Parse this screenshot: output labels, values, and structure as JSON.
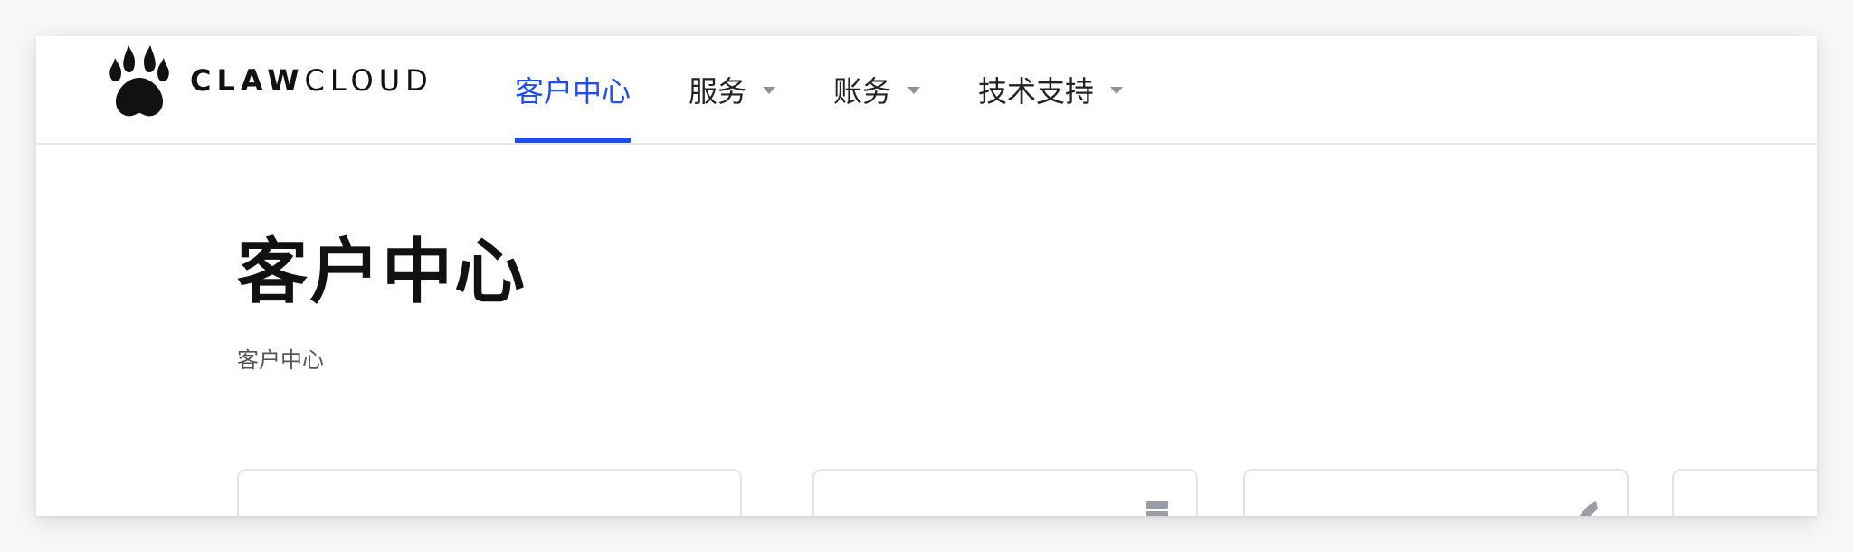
{
  "brand": {
    "logo_icon": "paw-icon",
    "name_bold": "CLAW",
    "name_light": "CLOUD"
  },
  "nav": {
    "items": [
      {
        "label": "客户中心",
        "active": true,
        "has_dropdown": false
      },
      {
        "label": "服务",
        "active": false,
        "has_dropdown": true
      },
      {
        "label": "账务",
        "active": false,
        "has_dropdown": true
      },
      {
        "label": "技术支持",
        "active": false,
        "has_dropdown": true
      }
    ],
    "active_color": "#1f4ef5"
  },
  "page": {
    "title": "客户中心",
    "breadcrumb": "客户中心"
  },
  "cards": [
    {
      "icon": ""
    },
    {
      "icon": "server-icon"
    },
    {
      "icon": "tag-icon"
    },
    {
      "icon": ""
    }
  ]
}
